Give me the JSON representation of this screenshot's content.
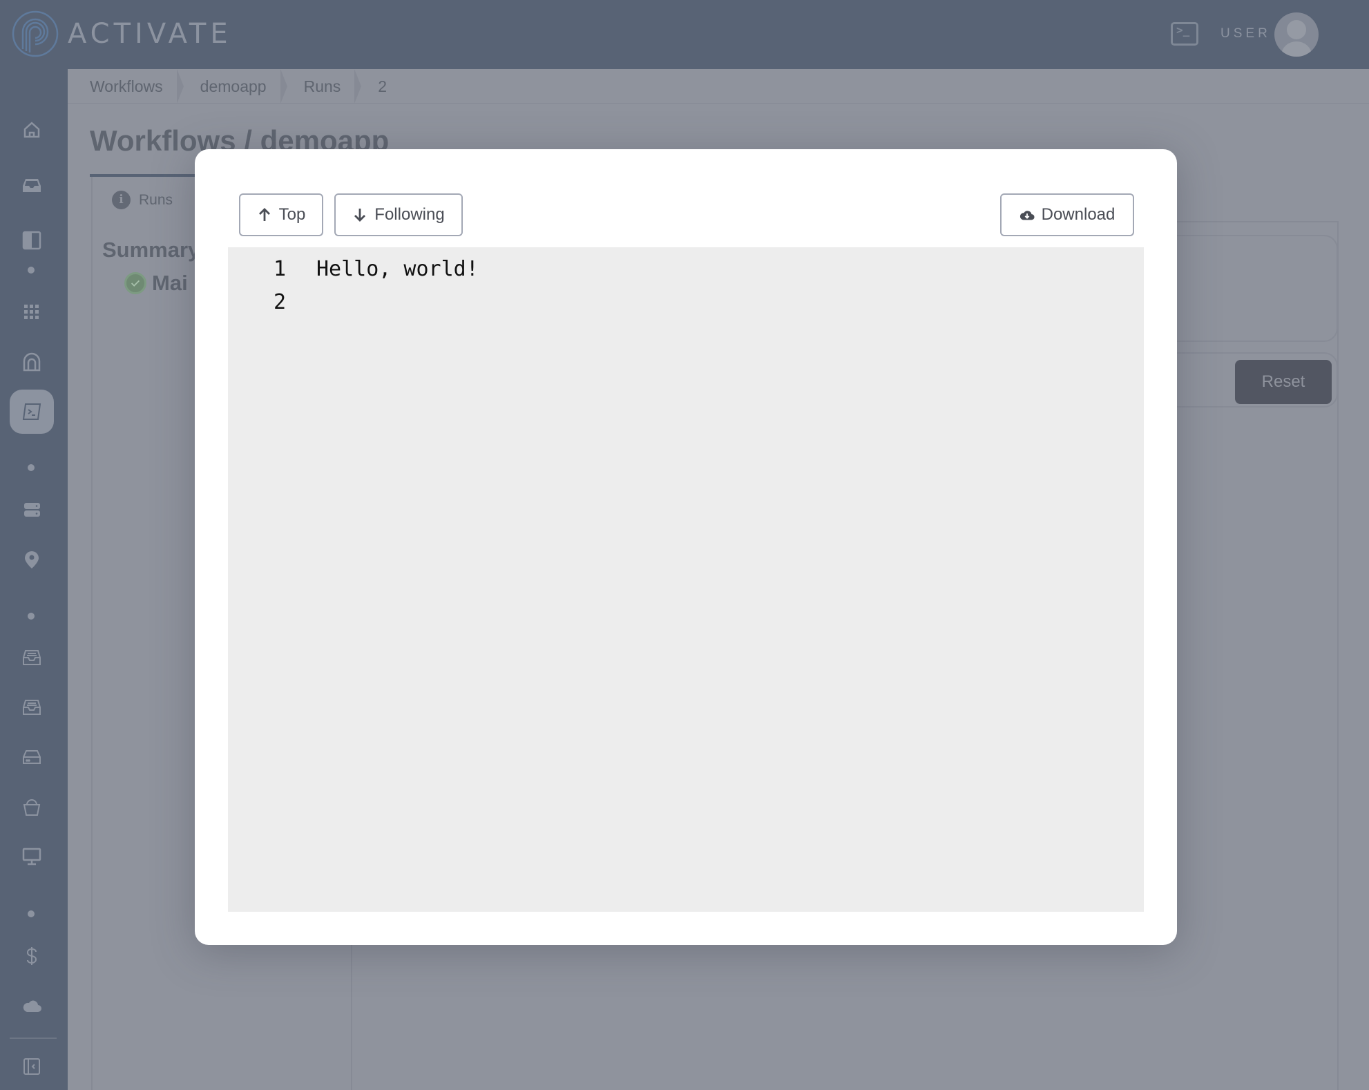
{
  "header": {
    "brand": "ACTIVATE",
    "terminal_icon_glyph": ">_",
    "user_label": "USER"
  },
  "sidebar": {
    "items": [
      {
        "icon": "home-icon",
        "active": false
      },
      {
        "icon": "inbox-icon",
        "active": false
      },
      {
        "icon": "sidebar-layout-icon",
        "active": false
      },
      {
        "icon": "grid-icon",
        "active": false
      },
      {
        "icon": "tunnel-icon",
        "active": false
      },
      {
        "icon": "terminal-icon",
        "active": true
      },
      {
        "icon": "server-icon",
        "active": false
      },
      {
        "icon": "location-pin-icon",
        "active": false
      },
      {
        "icon": "tray-icon",
        "active": false
      },
      {
        "icon": "tray-icon",
        "active": false
      },
      {
        "icon": "hard-drive-icon",
        "active": false
      },
      {
        "icon": "bucket-icon",
        "active": false
      },
      {
        "icon": "monitor-icon",
        "active": false
      },
      {
        "icon": "dollar-icon",
        "active": false
      },
      {
        "icon": "cloud-icon",
        "active": false
      },
      {
        "icon": "collapse-sidebar-icon",
        "active": false
      }
    ]
  },
  "breadcrumb": [
    "Workflows",
    "demoapp",
    "Runs",
    "2"
  ],
  "page": {
    "title": "Workflows / demoapp",
    "tab_runs": "Runs",
    "summary_label": "Summary",
    "main_label": "Mai",
    "reset_label": "Reset"
  },
  "modal": {
    "top_label": "Top",
    "following_label": "Following",
    "download_label": "Download",
    "log_lines": [
      {
        "num": "1",
        "text": "Hello, world!"
      },
      {
        "num": "2",
        "text": ""
      }
    ]
  }
}
